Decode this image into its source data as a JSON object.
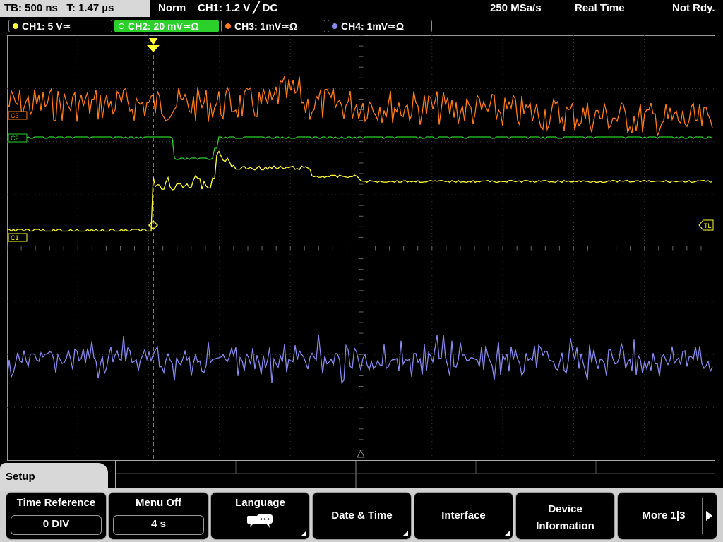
{
  "status": {
    "timebase": "TB: 500 ns",
    "time": "T: 1.47 µs",
    "mode": "Norm",
    "trigger": "CH1: 1.2 V ╱ DC",
    "sample_rate": "250 MSa/s",
    "acq_mode": "Real Time",
    "state": "Not Rdy."
  },
  "channels": [
    {
      "label": "CH1: 5 V≃",
      "color": "#ffff33"
    },
    {
      "label": "CH2: 20 mV≃Ω",
      "color": "#2bd02b"
    },
    {
      "label": "CH3: 1mV≃Ω",
      "color": "#ff7a1a"
    },
    {
      "label": "CH4: 1mV≃Ω",
      "color": "#8888ee"
    }
  ],
  "markers": {
    "c3": "C3",
    "c2": "C2",
    "c1": "C1",
    "tl": "TL"
  },
  "menu": {
    "title": "Setup",
    "time_reference": {
      "label": "Time Reference",
      "value": "0 DIV"
    },
    "menu_off": {
      "label": "Menu Off",
      "value": "4 s"
    },
    "language": {
      "label": "Language"
    },
    "date_time": {
      "label": "Date & Time"
    },
    "interface": {
      "label": "Interface"
    },
    "device_information": {
      "label_line1": "Device",
      "label_line2": "Information"
    },
    "more": {
      "label": "More 1|3"
    }
  }
}
